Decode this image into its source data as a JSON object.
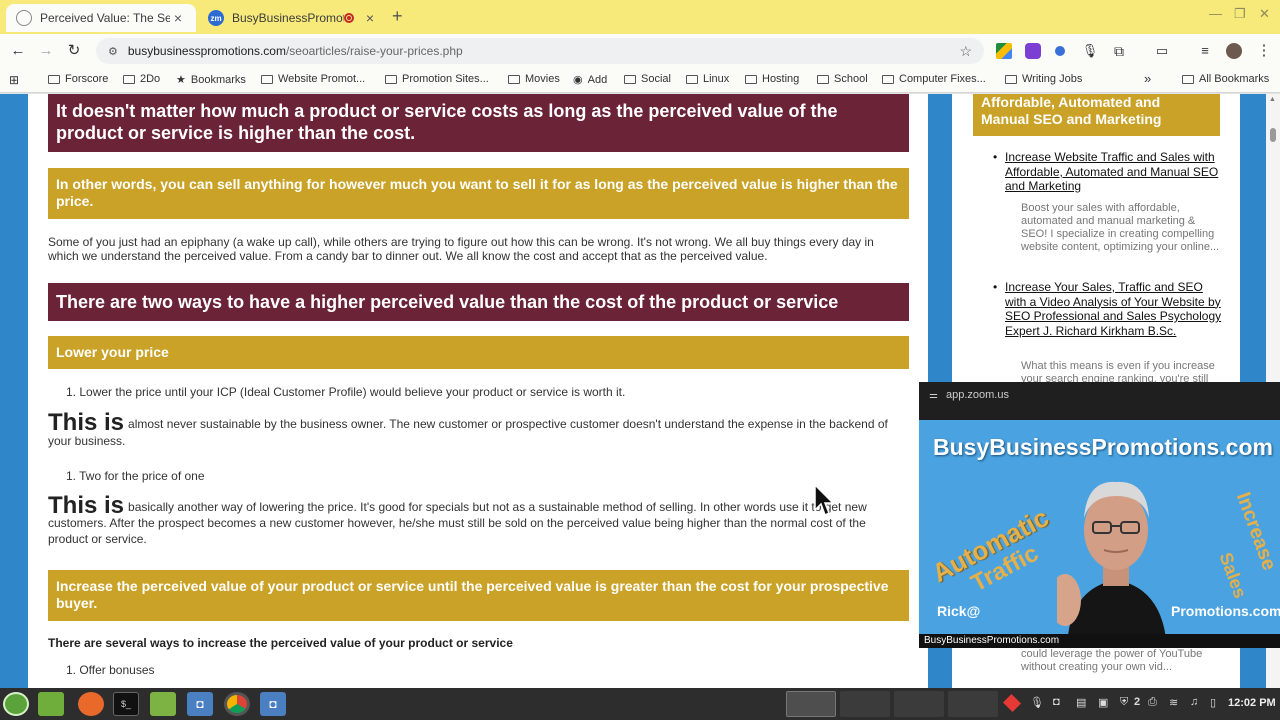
{
  "browser": {
    "tabs": [
      {
        "title": "Perceived Value: The Secret",
        "active": true
      },
      {
        "title": "BusyBusinessPromotion",
        "active": false,
        "favicon_text": "zm"
      }
    ],
    "url_domain": "busybusinesspromotions.com",
    "url_path": "/seoarticles/raise-your-prices.php",
    "bookmarks": [
      "Forscore",
      "2Do",
      "Bookmarks",
      "Website Promot...",
      "Promotion Sites...",
      "Movies",
      "Add",
      "Social",
      "Linux",
      "Hosting",
      "School",
      "Computer Fixes...",
      "Writing Jobs"
    ],
    "all_bookmarks": "All Bookmarks",
    "more": "»"
  },
  "article": {
    "heading1": "It doesn't matter how much a product or service costs as long as the perceived value of the product or service is higher than the cost.",
    "gold1": "In other words, you can sell anything for however much you want to sell it for as long as the perceived value is higher than the price.",
    "para1": "Some of you just had an epiphany (a wake up call), while others are trying to figure out how this can be wrong. It's not wrong. We all buy things every day in which we understand the perceived value. From a candy bar to dinner out. We all know the cost and accept that as the perceived value.",
    "heading2": "There are two ways to have a higher perceived value than the cost of the product or service",
    "gold2": "Lower your price",
    "li1": "1. Lower the price until your ICP (Ideal Customer Profile) would believe your product or service is worth it.",
    "big1": "This is",
    "para2": "almost never sustainable by the business owner. The new customer or prospective customer doesn't understand the expense in the backend of your business.",
    "li2": "1. Two for the price of one",
    "big2": "This is",
    "para3": "basically another way of lowering the price. It's good for specials but not as a sustainable method of selling. In other words use it to get new customers. After the prospect becomes a new customer however, he/she must still be sold on the perceived value being higher than the normal cost of the product or service.",
    "gold3": "Increase the perceived value of your product or service until the perceived value is greater than the cost for your prospective buyer.",
    "bold1": "There are several ways to increase the perceived value of your product or service",
    "li3": "1. Offer bonuses"
  },
  "sidebar": {
    "heading": "Affordable, Automated and Manual SEO and Marketing",
    "items": [
      {
        "link": "Increase Website Traffic and Sales with Affordable, Automated and Manual SEO and Marketing",
        "desc": "Boost your sales with affordable, automated and manual marketing & SEO! I specialize in creating compelling website content, optimizing your online..."
      },
      {
        "link": "Increase Your Sales, Traffic and SEO with a Video Analysis of Your Website by SEO Professional and Sales Psychology Expert J. Richard Kirkham B.Sc.",
        "desc": "What this means is even if you increase your search engine ranking, you're still"
      }
    ],
    "below_zoom_desc": "could leverage the power of YouTube without creating your own vid..."
  },
  "zoom": {
    "bar_title": "app.zoom.us",
    "brand": "BusyBusinessPromotions.com",
    "word_automatic": "Automatic",
    "word_traffic": "Traffic",
    "word_increase": "Increase",
    "word_sales": "Sales",
    "rick": "Rick@",
    "promos": "Promotions.com",
    "caption": "BusyBusinessPromotions.com"
  },
  "taskbar": {
    "badge_count": "2",
    "clock": "12:02 PM"
  },
  "colors": {
    "maroon": "#6b2338",
    "gold": "#c9a227",
    "page_blue": "#2f86c9",
    "tab_yellow": "#f7e97a"
  }
}
